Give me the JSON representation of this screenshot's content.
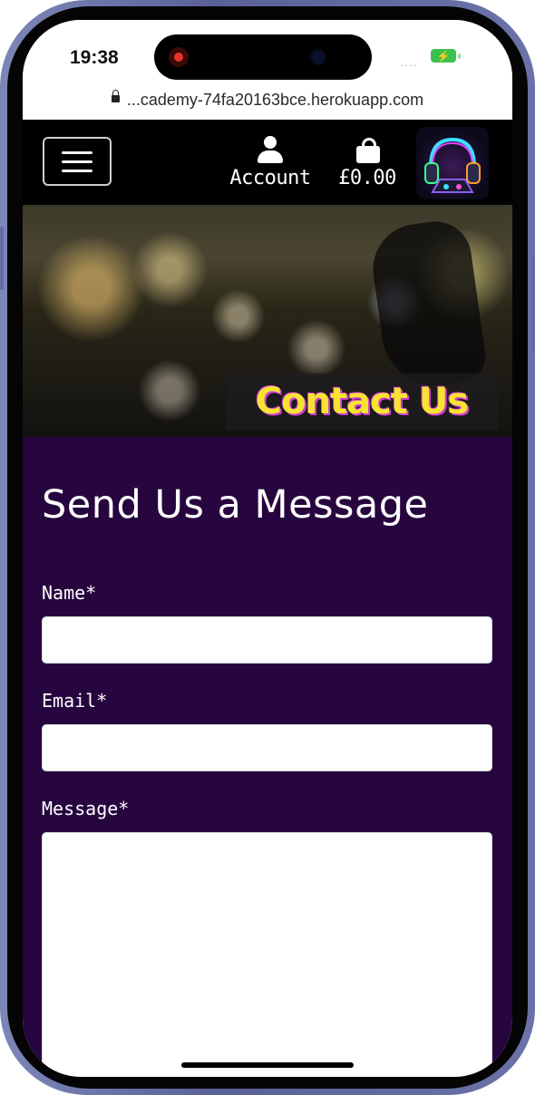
{
  "status_bar": {
    "time": "19:38",
    "signal": "....",
    "battery_icon": "charging-battery-icon",
    "url": "...cademy-74fa20163bce.herokuapp.com"
  },
  "header": {
    "menu_icon": "hamburger-menu-icon",
    "account_label": "Account",
    "cart_total": "£0.00",
    "logo_icon": "dj-headphones-logo"
  },
  "hero": {
    "title": "Contact Us"
  },
  "form": {
    "heading": "Send Us a Message",
    "name_label": "Name*",
    "name_value": "",
    "email_label": "Email*",
    "email_value": "",
    "message_label": "Message*",
    "message_value": ""
  },
  "colors": {
    "page_bg": "#27063f",
    "hero_title": "#f6e431",
    "hero_title_shadow": "#d13fd6",
    "header_bg": "#000000"
  }
}
